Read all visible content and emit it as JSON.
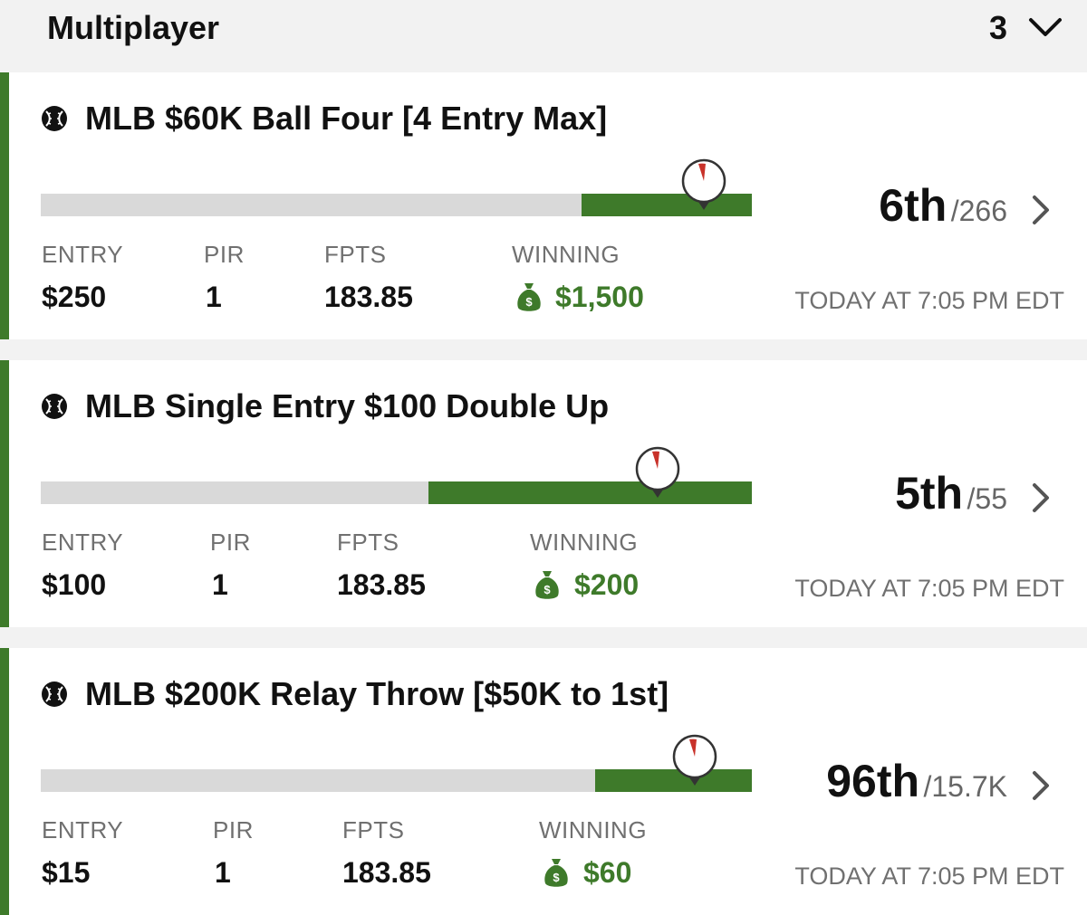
{
  "header": {
    "title": "Multiplayer",
    "count": "3"
  },
  "colors": {
    "accent": "#3e7a2a",
    "track": "#d9d9d9",
    "timer_red": "#c8322a"
  },
  "labels": {
    "entry": "ENTRY",
    "pir": "PIR",
    "fpts": "FPTS",
    "winning": "WINNING"
  },
  "contests": [
    {
      "title": "MLB $60K Ball Four [4 Entry Max]",
      "progress_fraction": 0.24,
      "rank": "6th",
      "total": "/266",
      "entry": "$250",
      "pir": "1",
      "fpts": "183.85",
      "winning": "$1,500",
      "start": "TODAY AT 7:05 PM EDT"
    },
    {
      "title": "MLB Single Entry $100 Double Up",
      "progress_fraction": 0.455,
      "rank": "5th",
      "total": "/55",
      "entry": "$100",
      "pir": "1",
      "fpts": "183.85",
      "winning": "$200",
      "start": "TODAY AT 7:05 PM EDT"
    },
    {
      "title": "MLB $200K Relay Throw [$50K to 1st]",
      "progress_fraction": 0.22,
      "rank": "96th",
      "total": "/15.7K",
      "entry": "$15",
      "pir": "1",
      "fpts": "183.85",
      "winning": "$60",
      "start": "TODAY AT 7:05 PM EDT"
    }
  ]
}
